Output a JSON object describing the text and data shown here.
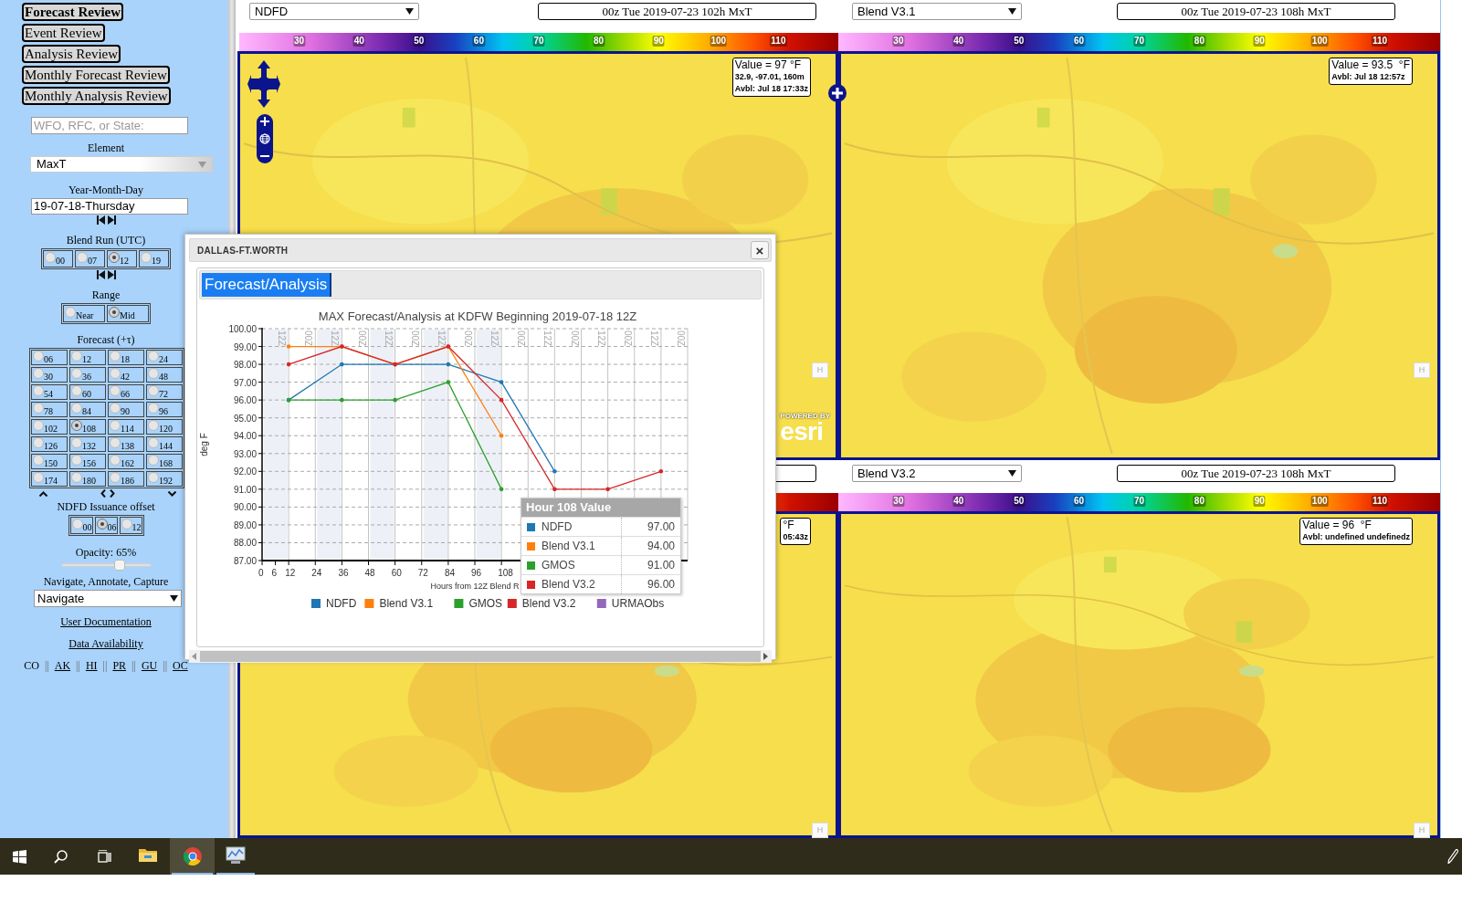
{
  "sidebar": {
    "nav_buttons": [
      {
        "label": "Forecast Review",
        "selected": true
      },
      {
        "label": "Event Review",
        "selected": false
      },
      {
        "label": "Analysis Review",
        "selected": false
      },
      {
        "label": "Monthly Forecast Review",
        "selected": false
      },
      {
        "label": "Monthly Analysis Review",
        "selected": false
      }
    ],
    "site_field": {
      "placeholder": "WFO, RFC, or State:"
    },
    "element": {
      "label": "Element",
      "value": "MaxT"
    },
    "date": {
      "label": "Year-Month-Day",
      "value": "19-07-18-Thursday"
    },
    "blend_run": {
      "label": "Blend Run (UTC)",
      "options": [
        {
          "label": "00",
          "selected": false
        },
        {
          "label": "07",
          "selected": false
        },
        {
          "label": "12",
          "selected": true
        },
        {
          "label": "19",
          "selected": false
        }
      ]
    },
    "range": {
      "label": "Range",
      "options": [
        {
          "label": "Near",
          "selected": false
        },
        {
          "label": "Mid",
          "selected": true
        }
      ]
    },
    "forecast": {
      "label": "Forecast (+τ)",
      "options": [
        {
          "label": "06",
          "selected": false
        },
        {
          "label": "12",
          "selected": false
        },
        {
          "label": "18",
          "selected": false
        },
        {
          "label": "24",
          "selected": false
        },
        {
          "label": "30",
          "selected": false
        },
        {
          "label": "36",
          "selected": false
        },
        {
          "label": "42",
          "selected": false
        },
        {
          "label": "48",
          "selected": false
        },
        {
          "label": "54",
          "selected": false
        },
        {
          "label": "60",
          "selected": false
        },
        {
          "label": "66",
          "selected": false
        },
        {
          "label": "72",
          "selected": false
        },
        {
          "label": "78",
          "selected": false
        },
        {
          "label": "84",
          "selected": false
        },
        {
          "label": "90",
          "selected": false
        },
        {
          "label": "96",
          "selected": false
        },
        {
          "label": "102",
          "selected": false
        },
        {
          "label": "108",
          "selected": true
        },
        {
          "label": "114",
          "selected": false
        },
        {
          "label": "120",
          "selected": false
        },
        {
          "label": "126",
          "selected": false
        },
        {
          "label": "132",
          "selected": false
        },
        {
          "label": "138",
          "selected": false
        },
        {
          "label": "144",
          "selected": false
        },
        {
          "label": "150",
          "selected": false
        },
        {
          "label": "156",
          "selected": false
        },
        {
          "label": "162",
          "selected": false
        },
        {
          "label": "168",
          "selected": false
        },
        {
          "label": "174",
          "selected": false
        },
        {
          "label": "180",
          "selected": false
        },
        {
          "label": "186",
          "selected": false
        },
        {
          "label": "192",
          "selected": false
        }
      ]
    },
    "issuance": {
      "label": "NDFD Issuance offset",
      "options": [
        {
          "label": "00",
          "selected": false
        },
        {
          "label": "06",
          "selected": true
        },
        {
          "label": "12",
          "selected": false
        }
      ]
    },
    "opacity": {
      "label": "Opacity: 65%",
      "level": 0.65
    },
    "mode": {
      "label": "Navigate, Annotate, Capture",
      "value": "Navigate"
    },
    "links": [
      {
        "label": "User Documentation"
      },
      {
        "label": "Data Availability"
      }
    ],
    "region_separator": "||",
    "regions": [
      {
        "label": "CO",
        "current": true
      },
      {
        "label": "AK",
        "current": false
      },
      {
        "label": "HI",
        "current": false
      },
      {
        "label": "PR",
        "current": false
      },
      {
        "label": "GU",
        "current": false
      },
      {
        "label": "OC",
        "current": false
      }
    ]
  },
  "panels": [
    {
      "source": "NDFD",
      "title": "00z Tue 2019-07-23 102h MxT",
      "scale_labels": [
        "30",
        "40",
        "50",
        "60",
        "70",
        "80",
        "90",
        "100",
        "110"
      ],
      "readout": [
        "Value = 97 °F",
        "32.9, -97.01, 160m",
        "Avbl: Jul 18 17:33z"
      ],
      "home_button": "H",
      "navigation": true,
      "attribution": {
        "caption": "POWERED BY",
        "logo": "esri"
      }
    },
    {
      "source": "Blend V3.1",
      "title": "00z Tue 2019-07-23 108h MxT",
      "scale_labels": [
        "30",
        "40",
        "50",
        "60",
        "70",
        "80",
        "90",
        "100",
        "110"
      ],
      "readout": [
        "Value = 93.5  °F",
        "Avbl: Jul 18 12:57z"
      ],
      "home_button": "H",
      "navigation": false
    },
    {
      "readout": [
        "°F",
        "05:43z"
      ],
      "home_button": "H",
      "navigation": false
    },
    {
      "source": "Blend V3.2",
      "title": "00z Tue 2019-07-23 108h MxT",
      "scale_labels": [
        "30",
        "40",
        "50",
        "60",
        "70",
        "80",
        "90",
        "100",
        "110"
      ],
      "readout": [
        "Value = 96  °F",
        "Avbl: undefined undefinedz"
      ],
      "home_button": "H",
      "navigation": false
    }
  ],
  "popup": {
    "title": "DALLAS-FT.WORTH",
    "close": "×",
    "tabs": [
      {
        "label": "Forecast/Analysis",
        "selected": true
      }
    ],
    "band_labels": [
      "12Z",
      "00Z",
      "12Z",
      "00Z",
      "12Z",
      "00Z",
      "12Z",
      "00Z",
      "12Z",
      "00Z",
      "12Z",
      "00Z",
      "12Z",
      "00Z",
      "12Z",
      "00Z"
    ],
    "chart_data": {
      "type": "line",
      "title": "MAX Forecast/Analysis at KDFW Beginning 2019-07-18 12Z",
      "xlabel": "Hours from 12Z Blend R",
      "ylabel": "deg F",
      "x": [
        12,
        36,
        60,
        84,
        108,
        132,
        156,
        180
      ],
      "series": [
        {
          "name": "NDFD",
          "color": "#1f77b4",
          "values": [
            96,
            98,
            98,
            98,
            97,
            92,
            null,
            null
          ]
        },
        {
          "name": "Blend V3.1",
          "color": "#ff7f0e",
          "values": [
            99,
            99,
            98,
            99,
            94,
            null,
            null,
            null
          ]
        },
        {
          "name": "GMOS",
          "color": "#2ca02c",
          "values": [
            96,
            96,
            96,
            97,
            91,
            null,
            null,
            null
          ]
        },
        {
          "name": "Blend V3.2",
          "color": "#d62728",
          "values": [
            98,
            99,
            98,
            99,
            96,
            91,
            91,
            92
          ]
        },
        {
          "name": "URMAObs",
          "color": "#9467bd",
          "values": [
            null,
            null,
            null,
            null,
            null,
            null,
            null,
            null
          ]
        }
      ],
      "xlim": [
        0,
        192
      ],
      "ylim": [
        87,
        100
      ],
      "xticks": [
        {
          "value": 0,
          "label": "0"
        },
        {
          "value": 6,
          "label": "6"
        },
        {
          "value": 12,
          "label": "12"
        },
        {
          "value": 24,
          "label": "24"
        },
        {
          "value": 36,
          "label": "36"
        },
        {
          "value": 48,
          "label": "48"
        },
        {
          "value": 60,
          "label": "60"
        },
        {
          "value": 72,
          "label": "72"
        },
        {
          "value": 84,
          "label": "84"
        },
        {
          "value": 96,
          "label": "96"
        },
        {
          "value": 108,
          "label": "108"
        }
      ],
      "grid": true,
      "legend": "bottom",
      "yticks": [
        {
          "value": 87,
          "label": "87.00"
        },
        {
          "value": 88,
          "label": "88.00"
        },
        {
          "value": 89,
          "label": "89.00"
        },
        {
          "value": 90,
          "label": "90.00"
        },
        {
          "value": 91,
          "label": "91.00"
        },
        {
          "value": 92,
          "label": "92.00"
        },
        {
          "value": 93,
          "label": "93.00"
        },
        {
          "value": 94,
          "label": "94.00"
        },
        {
          "value": 95,
          "label": "95.00"
        },
        {
          "value": 96,
          "label": "96.00"
        },
        {
          "value": 97,
          "label": "97.00"
        },
        {
          "value": 98,
          "label": "98.00"
        },
        {
          "value": 99,
          "label": "99.00"
        },
        {
          "value": 100,
          "label": "100.00"
        }
      ]
    },
    "tooltip": {
      "title": "Hour 108 Value",
      "rows": [
        {
          "name": "NDFD",
          "value": "97.00",
          "color": "#1f77b4"
        },
        {
          "name": "Blend V3.1",
          "value": "94.00",
          "color": "#ff7f0e"
        },
        {
          "name": "GMOS",
          "value": "91.00",
          "color": "#2ca02c"
        },
        {
          "name": "Blend V3.2",
          "value": "96.00",
          "color": "#d62728"
        }
      ]
    }
  },
  "taskbar": {
    "items": [
      {
        "kind": "start",
        "selected": false,
        "running": false
      },
      {
        "kind": "search",
        "selected": false,
        "running": false
      },
      {
        "kind": "taskview",
        "selected": false,
        "running": false
      },
      {
        "kind": "folder",
        "selected": false,
        "running": false
      },
      {
        "kind": "browser",
        "selected": true,
        "running": true
      },
      {
        "kind": "app",
        "selected": false,
        "running": true
      }
    ]
  }
}
